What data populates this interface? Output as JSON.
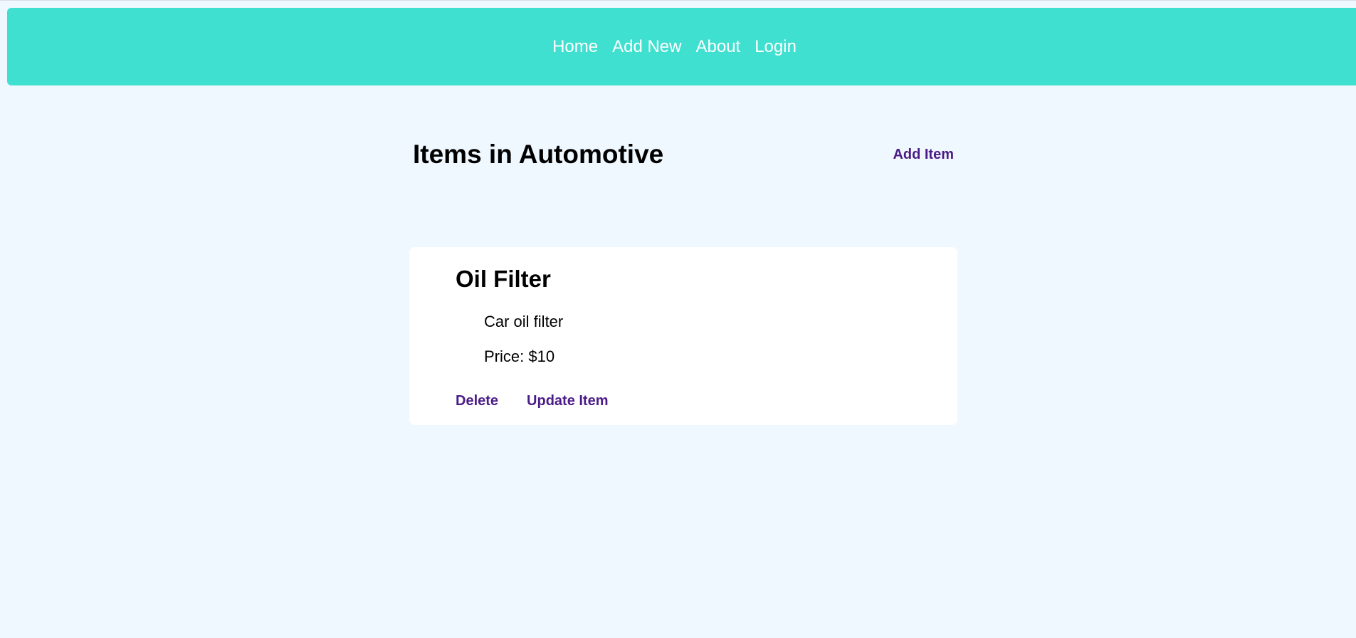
{
  "nav": {
    "links": [
      {
        "label": "Home"
      },
      {
        "label": "Add New"
      },
      {
        "label": "About"
      },
      {
        "label": "Login"
      }
    ]
  },
  "header": {
    "title": "Items in Automotive",
    "add_item_label": "Add Item"
  },
  "item": {
    "name": "Oil Filter",
    "description": "Car oil filter",
    "price": "Price: $10",
    "delete_label": "Delete",
    "update_label": "Update Item"
  },
  "colors": {
    "navbar": "#40e0d0",
    "background": "#eff7ff",
    "link": "#4b1c87",
    "card": "#ffffff"
  }
}
